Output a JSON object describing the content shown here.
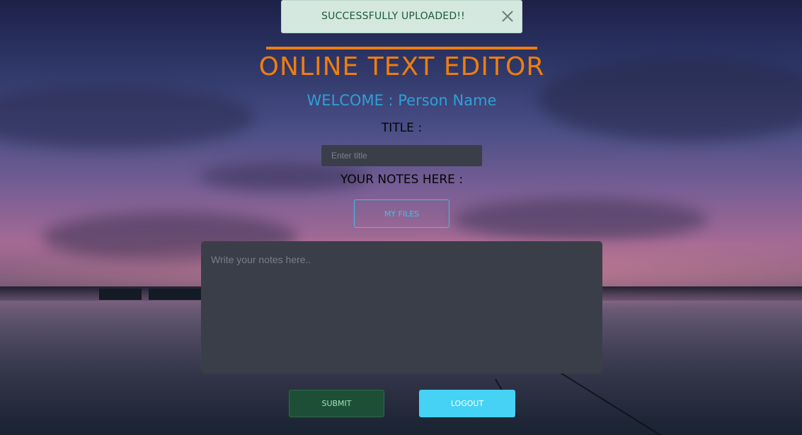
{
  "toast": {
    "message": "SUCCESSFULLY UPLOADED!!",
    "close_icon": "close-icon"
  },
  "header": {
    "app_title": "ONLINE TEXT EDITOR",
    "welcome": "WELCOME : Person Name",
    "accent_color": "#f07d0e",
    "welcome_color": "#2fa0d6"
  },
  "form": {
    "title_label": "TITLE :",
    "title_placeholder": "Enter title",
    "title_value": "",
    "notes_label": "YOUR NOTES HERE :",
    "my_files_label": "MY FILES",
    "notes_placeholder": "Write your notes here..",
    "notes_value": "",
    "submit_label": "SUBMIT",
    "logout_label": "LOGOUT"
  },
  "colors": {
    "toast_bg": "#d5e8df",
    "toast_text": "#1c5a3a",
    "input_bg": "#3a3e48",
    "my_files_border": "#3ec2e8",
    "submit_bg": "#1d4f36",
    "logout_bg": "#45d2f5"
  }
}
